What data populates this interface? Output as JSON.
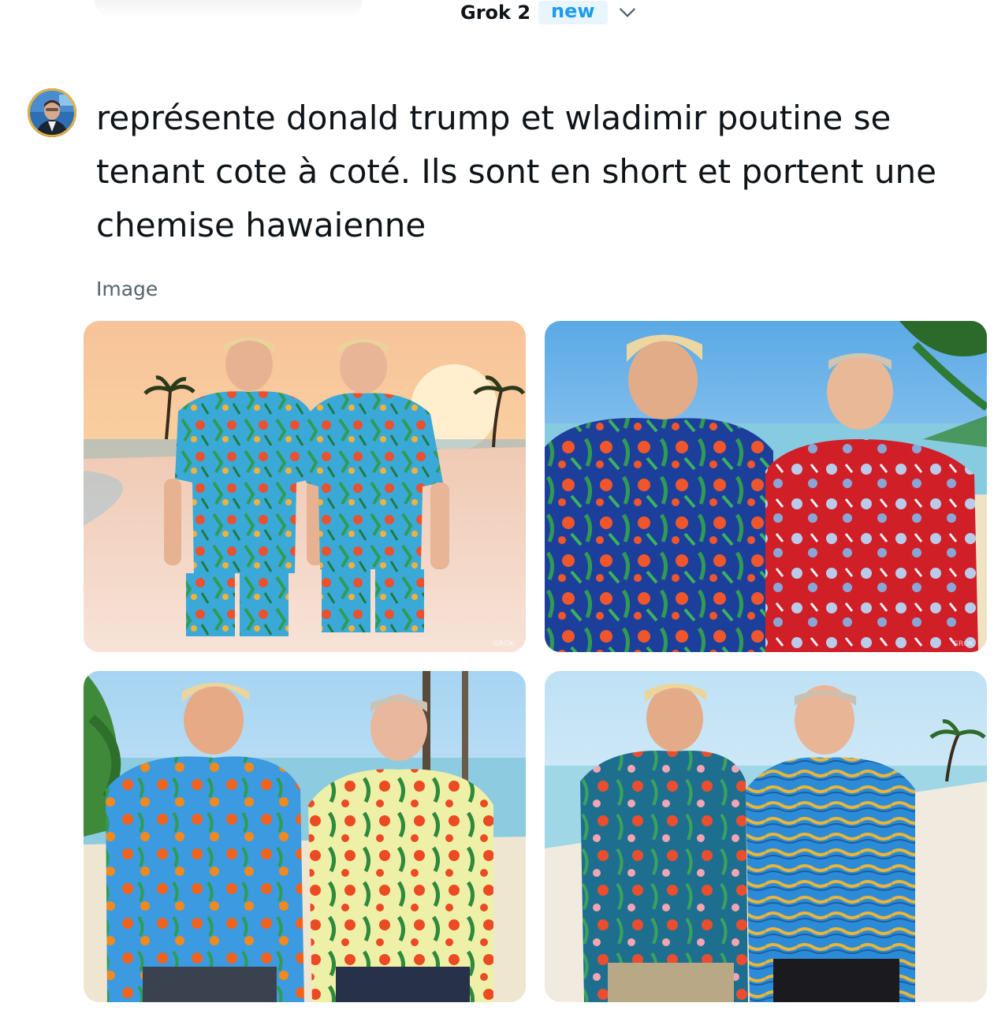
{
  "header": {
    "model_name": "Grok 2",
    "model_badge": "new",
    "model_dropdown_icon": "chevron-down-icon"
  },
  "message": {
    "avatar_icon": "user-avatar",
    "prompt": "représente donald trump et wladimir poutine se tenant cote à coté. Ils sont en short et portent une chemise hawaienne"
  },
  "result": {
    "label": "Image",
    "watermark": "GROK",
    "images": [
      "two-men-hawaiian-shirts-shorts-sunset-beach",
      "two-men-blue-and-red-hawaiian-shirts-beach",
      "two-men-blue-and-yellow-hawaiian-shirts-beach",
      "two-men-teal-and-blue-hawaiian-shirts-beach"
    ]
  },
  "colors": {
    "accent": "#1d9bf0",
    "badge_bg": "#e8f5fd",
    "text": "#0f1419",
    "muted": "#536471"
  }
}
